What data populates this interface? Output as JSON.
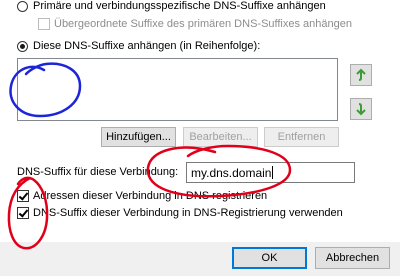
{
  "options": {
    "primary_suffixes_label": "Primäre und verbindungsspezifische DNS-Suffixe anhängen",
    "parent_suffixes_label": "Übergeordnete Suffixe des primären DNS-Suffixes anhängen",
    "these_suffixes_label": "Diese DNS-Suffixe anhängen (in Reihenfolge):"
  },
  "suffix_list": {
    "items": []
  },
  "list_buttons": {
    "add_label": "Hinzufügen...",
    "edit_label": "Bearbeiten...",
    "remove_label": "Entfernen"
  },
  "connection_suffix": {
    "label": "DNS-Suffix für diese Verbindung:",
    "value": "my.dns.domain"
  },
  "registration": {
    "register_addresses_label": "Adressen dieser Verbindung in DNS registrieren",
    "use_suffix_label": "DNS-Suffix dieser Verbindung in DNS-Registrierung verwenden"
  },
  "footer": {
    "ok_label": "OK",
    "cancel_label": "Abbrechen"
  },
  "icons": {
    "move_up": "arrow-up-icon",
    "move_down": "arrow-down-icon"
  },
  "colors": {
    "arrow_green": "#3f9b35",
    "annotation_red": "#e0001a",
    "annotation_blue": "#1c25d8",
    "default_button_border": "#0078d7"
  }
}
